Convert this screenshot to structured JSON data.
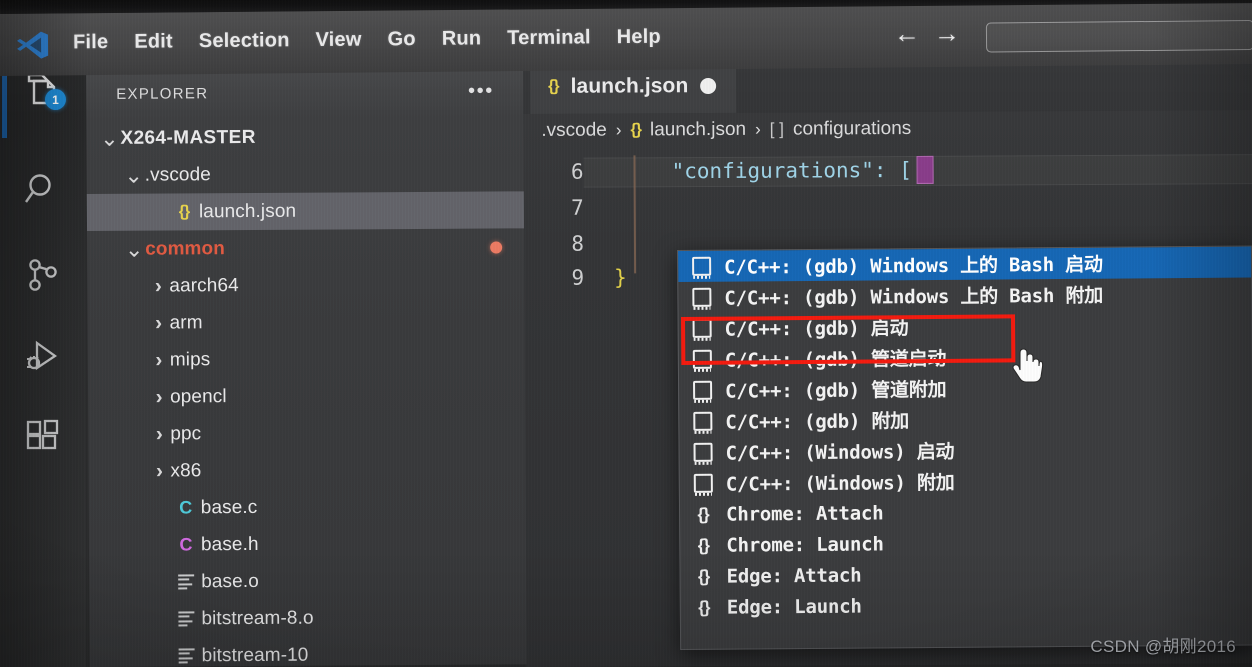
{
  "window": {
    "app_logo": "vscode-logo-icon",
    "menu": [
      "File",
      "Edit",
      "Selection",
      "View",
      "Go",
      "Run",
      "Terminal",
      "Help"
    ],
    "nav_back": "←",
    "nav_forward": "→",
    "command_center_value": ""
  },
  "activity_bar": {
    "items": [
      {
        "name": "explorer",
        "icon": "files-icon",
        "badge": "1",
        "active": true
      },
      {
        "name": "search",
        "icon": "search-icon",
        "badge": "",
        "active": false
      },
      {
        "name": "source-control",
        "icon": "source-control-icon",
        "badge": "",
        "active": false
      },
      {
        "name": "run-and-debug",
        "icon": "run-debug-icon",
        "badge": "",
        "active": false
      },
      {
        "name": "extensions",
        "icon": "extensions-icon",
        "badge": "",
        "active": false
      }
    ]
  },
  "sidebar": {
    "title": "EXPLORER",
    "more_actions": "•••",
    "tree": [
      {
        "label": "X264-MASTER",
        "indent": 0,
        "twisty": "down",
        "kind": "root",
        "icon": "",
        "selected": false,
        "modified": false
      },
      {
        "label": ".vscode",
        "indent": 1,
        "twisty": "down",
        "kind": "folder",
        "icon": "",
        "selected": false,
        "modified": false
      },
      {
        "label": "launch.json",
        "indent": 2,
        "twisty": "none",
        "kind": "file",
        "icon": "json-icon",
        "selected": true,
        "modified": false
      },
      {
        "label": "common",
        "indent": 1,
        "twisty": "down",
        "kind": "folder-warn",
        "icon": "",
        "selected": false,
        "modified": true
      },
      {
        "label": "aarch64",
        "indent": 2,
        "twisty": "right",
        "kind": "folder",
        "icon": "",
        "selected": false,
        "modified": false
      },
      {
        "label": "arm",
        "indent": 2,
        "twisty": "right",
        "kind": "folder",
        "icon": "",
        "selected": false,
        "modified": false
      },
      {
        "label": "mips",
        "indent": 2,
        "twisty": "right",
        "kind": "folder",
        "icon": "",
        "selected": false,
        "modified": false
      },
      {
        "label": "opencl",
        "indent": 2,
        "twisty": "right",
        "kind": "folder",
        "icon": "",
        "selected": false,
        "modified": false
      },
      {
        "label": "ppc",
        "indent": 2,
        "twisty": "right",
        "kind": "folder",
        "icon": "",
        "selected": false,
        "modified": false
      },
      {
        "label": "x86",
        "indent": 2,
        "twisty": "right",
        "kind": "folder",
        "icon": "",
        "selected": false,
        "modified": false
      },
      {
        "label": "base.c",
        "indent": 2,
        "twisty": "none",
        "kind": "file",
        "icon": "c-source-icon",
        "selected": false,
        "modified": false
      },
      {
        "label": "base.h",
        "indent": 2,
        "twisty": "none",
        "kind": "file",
        "icon": "c-header-icon",
        "selected": false,
        "modified": false
      },
      {
        "label": "base.o",
        "indent": 2,
        "twisty": "none",
        "kind": "file",
        "icon": "binary-icon",
        "selected": false,
        "modified": false
      },
      {
        "label": "bitstream-8.o",
        "indent": 2,
        "twisty": "none",
        "kind": "file",
        "icon": "binary-icon",
        "selected": false,
        "modified": false
      },
      {
        "label": "bitstream-10",
        "indent": 2,
        "twisty": "none",
        "kind": "file",
        "icon": "binary-icon",
        "selected": false,
        "modified": false
      }
    ]
  },
  "editor": {
    "tab": {
      "label": "launch.json",
      "icon": "json-icon",
      "dirty": true
    },
    "breadcrumb": [
      {
        "label": ".vscode",
        "icon": ""
      },
      {
        "label": "launch.json",
        "icon": "json-icon"
      },
      {
        "label": "configurations",
        "icon": "array-icon"
      }
    ],
    "breadcrumb_separator": "›",
    "lines": [
      {
        "number": "6",
        "text": "\"configurations\": ["
      },
      {
        "number": "7",
        "text": ""
      },
      {
        "number": "8",
        "text": ""
      },
      {
        "number": "9",
        "text": "}"
      }
    ]
  },
  "suggest": {
    "items": [
      {
        "label": "C/C++: (gdb) Windows 上的 Bash 启动",
        "icon": "debug-config-icon",
        "active": true,
        "highlighted": false
      },
      {
        "label": "C/C++: (gdb) Windows 上的 Bash 附加",
        "icon": "debug-config-icon",
        "active": false,
        "highlighted": false
      },
      {
        "label": "C/C++: (gdb) 启动",
        "icon": "debug-config-icon",
        "active": false,
        "highlighted": true
      },
      {
        "label": "C/C++: (gdb) 管道启动",
        "icon": "debug-config-icon",
        "active": false,
        "highlighted": false
      },
      {
        "label": "C/C++: (gdb) 管道附加",
        "icon": "debug-config-icon",
        "active": false,
        "highlighted": false
      },
      {
        "label": "C/C++: (gdb) 附加",
        "icon": "debug-config-icon",
        "active": false,
        "highlighted": false
      },
      {
        "label": "C/C++: (Windows) 启动",
        "icon": "debug-config-icon",
        "active": false,
        "highlighted": false
      },
      {
        "label": "C/C++: (Windows) 附加",
        "icon": "debug-config-icon",
        "active": false,
        "highlighted": false
      },
      {
        "label": "Chrome: Attach",
        "icon": "braces-icon",
        "active": false,
        "highlighted": false
      },
      {
        "label": "Chrome: Launch",
        "icon": "braces-icon",
        "active": false,
        "highlighted": false
      },
      {
        "label": "Edge: Attach",
        "icon": "braces-icon",
        "active": false,
        "highlighted": false
      },
      {
        "label": "Edge: Launch",
        "icon": "braces-icon",
        "active": false,
        "highlighted": false
      }
    ]
  },
  "annotation": {
    "highlight_color": "#f41b0f",
    "cursor": "pointer-hand-cursor"
  },
  "watermark": {
    "text": "CSDN @胡刚2016"
  },
  "colors": {
    "accent_blue": "#1667b5",
    "selection_gray": "#63646a",
    "modified_dot": "#ec7b63",
    "json_yellow": "#e8d44d",
    "warn_orange": "#e05a42",
    "annotation_red": "#f41b0f"
  }
}
